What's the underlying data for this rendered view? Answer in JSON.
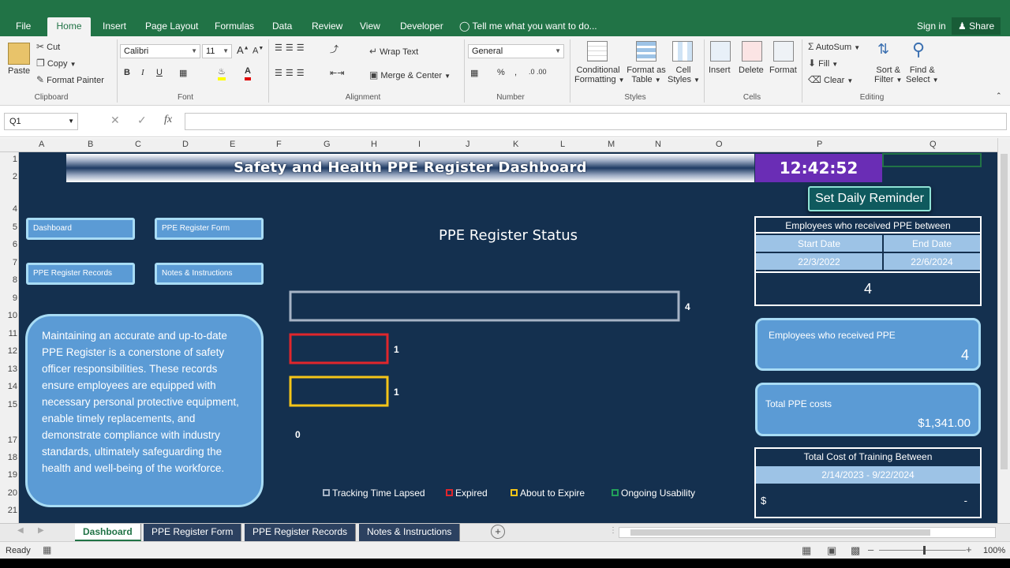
{
  "ribbon_tabs": [
    "File",
    "Home",
    "Insert",
    "Page Layout",
    "Formulas",
    "Data",
    "Review",
    "View",
    "Developer"
  ],
  "active_tab": "Home",
  "tell_me": "Tell me what you want to do...",
  "sign_in": "Sign in",
  "share": "Share",
  "clipboard": {
    "paste": "Paste",
    "cut": "Cut",
    "copy": "Copy",
    "format_painter": "Format Painter",
    "group": "Clipboard"
  },
  "font": {
    "name": "Calibri",
    "size": "11",
    "group": "Font"
  },
  "alignment": {
    "wrap": "Wrap Text",
    "merge": "Merge & Center",
    "group": "Alignment"
  },
  "number": {
    "format": "General",
    "group": "Number"
  },
  "styles": {
    "conditional": "Conditional",
    "conditional2": "Formatting",
    "format_table": "Format as",
    "format_table2": "Table",
    "cell_styles": "Cell",
    "cell_styles2": "Styles",
    "group": "Styles"
  },
  "cells": {
    "insert": "Insert",
    "delete": "Delete",
    "format": "Format",
    "group": "Cells"
  },
  "editing": {
    "autosum": "AutoSum",
    "fill": "Fill",
    "clear": "Clear",
    "sort": "Sort &",
    "sort2": "Filter",
    "find": "Find &",
    "find2": "Select",
    "group": "Editing"
  },
  "formula_bar": {
    "name_box": "Q1",
    "fx": "fx",
    "cancel": "✕",
    "enter": "✓"
  },
  "columns": [
    "A",
    "B",
    "C",
    "D",
    "E",
    "F",
    "G",
    "H",
    "I",
    "J",
    "K",
    "L",
    "M",
    "N",
    "O",
    "P",
    "Q"
  ],
  "rows": [
    "1",
    "2",
    "4",
    "5",
    "6",
    "7",
    "8",
    "9",
    "10",
    "11",
    "12",
    "13",
    "14",
    "15",
    "17",
    "18",
    "19",
    "20",
    "21"
  ],
  "dashboard": {
    "title": "Safety and Health PPE Register Dashboard",
    "clock": "12:42:52",
    "nav": [
      "Dashboard",
      "PPE Register Form",
      "PPE Register Records",
      "Notes & Instructions"
    ],
    "info_text": "Maintaining an accurate and up-to-date PPE Register is a conerstone of safety officer responsibilities. These records ensure employees are equipped with necessary personal protective equipment, enable timely replacements, and demonstrate compliance with industry standards, ultimately safeguarding the health and well-being of the workforce.",
    "reminder_button": "Set Daily Reminder",
    "received_between": {
      "header": "Employees who received PPE between",
      "start_label": "Start Date",
      "end_label": "End Date",
      "start": "22/3/2022",
      "end": "22/6/2024",
      "count": "4"
    },
    "received_card": {
      "label": "Employees who received PPE",
      "value": "4"
    },
    "cost_card": {
      "label": "Total PPE costs",
      "value": "$1,341.00"
    },
    "training": {
      "header": "Total Cost of Training Between",
      "range": "2/14/2023 - 9/22/2024",
      "currency": "$",
      "value": "-"
    }
  },
  "chart_data": {
    "type": "bar",
    "title": "PPE Register Status",
    "orientation": "horizontal",
    "categories": [
      "Tracking Time Lapsed",
      "Expired",
      "About to Expire",
      "Ongoing Usability"
    ],
    "values": [
      4,
      1,
      1,
      0
    ],
    "colors": [
      "#a6b3c5",
      "#e0262c",
      "#f5c518",
      "#22a05a"
    ],
    "xlim": [
      0,
      4
    ],
    "legend": "bottom"
  },
  "sheet_tabs": [
    "Dashboard",
    "PPE Register Form",
    "PPE Register Records",
    "Notes & Instructions"
  ],
  "status": {
    "ready": "Ready",
    "zoom": "100%"
  }
}
